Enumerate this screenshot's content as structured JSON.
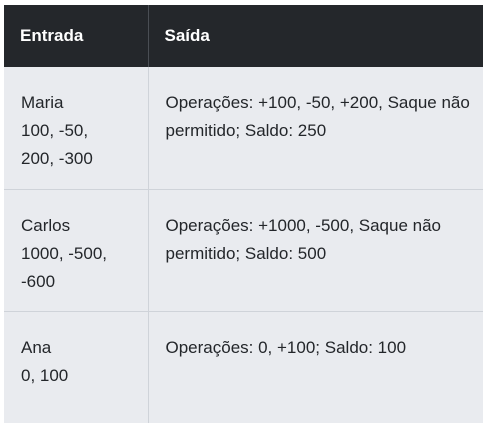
{
  "table": {
    "headers": [
      "Entrada",
      "Saída"
    ],
    "rows": [
      {
        "input_lines": [
          "Maria",
          "100, -50,",
          "200, -300"
        ],
        "output": "Operações: +100, -50, +200, Saque não permitido; Saldo: 250"
      },
      {
        "input_lines": [
          "Carlos",
          "1000, -500,",
          "-600"
        ],
        "output": "Operações: +1000, -500, Saque não permitido; Saldo: 500"
      },
      {
        "input_lines": [
          "Ana",
          "0, 100"
        ],
        "output": "Operações: 0, +100; Saldo: 100"
      }
    ]
  }
}
